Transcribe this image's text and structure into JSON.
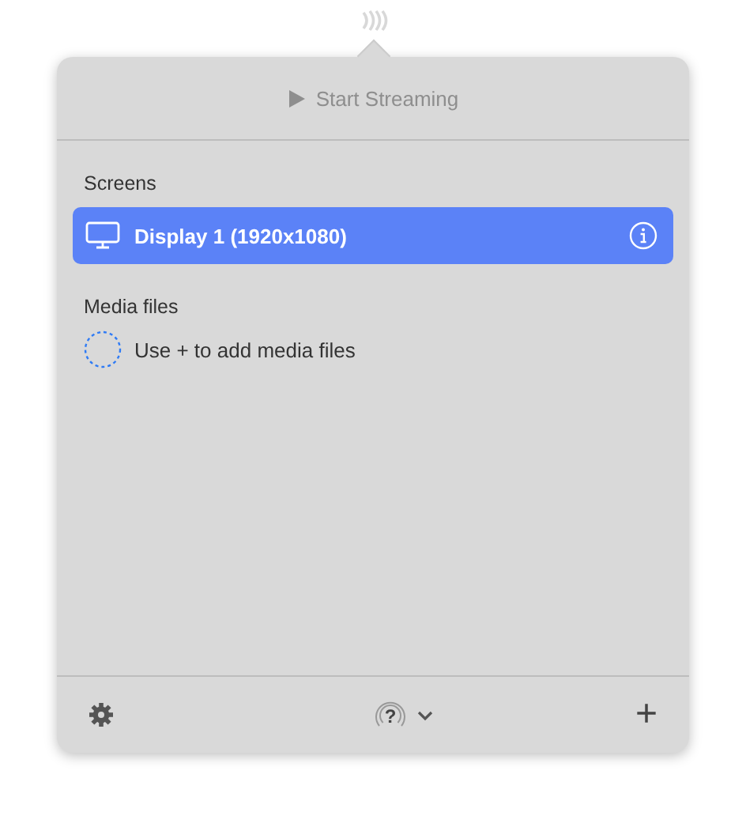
{
  "toolbar": {
    "start_button": {
      "label": "Start Streaming",
      "disabled": true
    }
  },
  "sections": [
    {
      "title": "Screens",
      "items": [
        {
          "kind": "screen",
          "label": "Display 1 (1920x1080)",
          "selected": true
        }
      ]
    },
    {
      "title": "Media files",
      "items": [
        {
          "kind": "placeholder",
          "label": "Use + to add media files"
        }
      ]
    }
  ],
  "footer": {
    "receiver_glyph": "?",
    "add_label": "+"
  }
}
